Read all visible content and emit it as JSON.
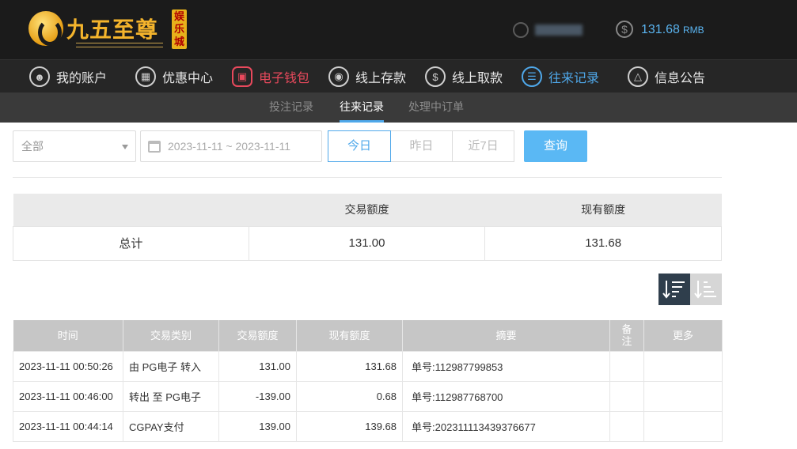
{
  "header": {
    "logo_text": "九五至尊",
    "logo_badge": "娱乐城",
    "balance": "131.68",
    "balance_unit": "RMB"
  },
  "nav": {
    "items": [
      {
        "label": "我的账户",
        "icon": "user-icon"
      },
      {
        "label": "优惠中心",
        "icon": "gift-icon"
      },
      {
        "label": "电子钱包",
        "icon": "wallet-icon"
      },
      {
        "label": "线上存款",
        "icon": "deposit-icon"
      },
      {
        "label": "线上取款",
        "icon": "withdraw-icon"
      },
      {
        "label": "往来记录",
        "icon": "records-icon"
      },
      {
        "label": "信息公告",
        "icon": "bell-icon"
      }
    ],
    "active": "往来记录",
    "colors": {
      "active": "#4fa8ea",
      "wallet": "#e8495c"
    }
  },
  "subnav": {
    "items": [
      "投注记录",
      "往来记录",
      "处理中订单"
    ],
    "active": "往来记录"
  },
  "filters": {
    "type_select": "全部",
    "date_range": "2023-11-11 ~ 2023-11-11",
    "quick": [
      "今日",
      "昨日",
      "近7日"
    ],
    "quick_active": "今日",
    "query_label": "查询"
  },
  "summary": {
    "headers": [
      "",
      "交易额度",
      "现有额度"
    ],
    "row": {
      "label": "总计",
      "amount": "131.00",
      "balance": "131.68"
    }
  },
  "records": {
    "headers": [
      "时间",
      "交易类别",
      "交易额度",
      "现有额度",
      "摘要",
      "备注",
      "更多"
    ],
    "rows": [
      {
        "time": "2023-11-11 00:50:26",
        "type": "由 PG电子 转入",
        "amount": "131.00",
        "balance": "131.68",
        "summary": "单号:112987799853",
        "note": "",
        "more": ""
      },
      {
        "time": "2023-11-11 00:46:00",
        "type": "转出 至 PG电子",
        "amount": "-139.00",
        "balance": "0.68",
        "summary": "单号:112987768700",
        "note": "",
        "more": ""
      },
      {
        "time": "2023-11-11 00:44:14",
        "type": "CGPAY支付",
        "amount": "139.00",
        "balance": "139.68",
        "summary": "单号:202311113439376677",
        "note": "",
        "more": ""
      }
    ]
  }
}
